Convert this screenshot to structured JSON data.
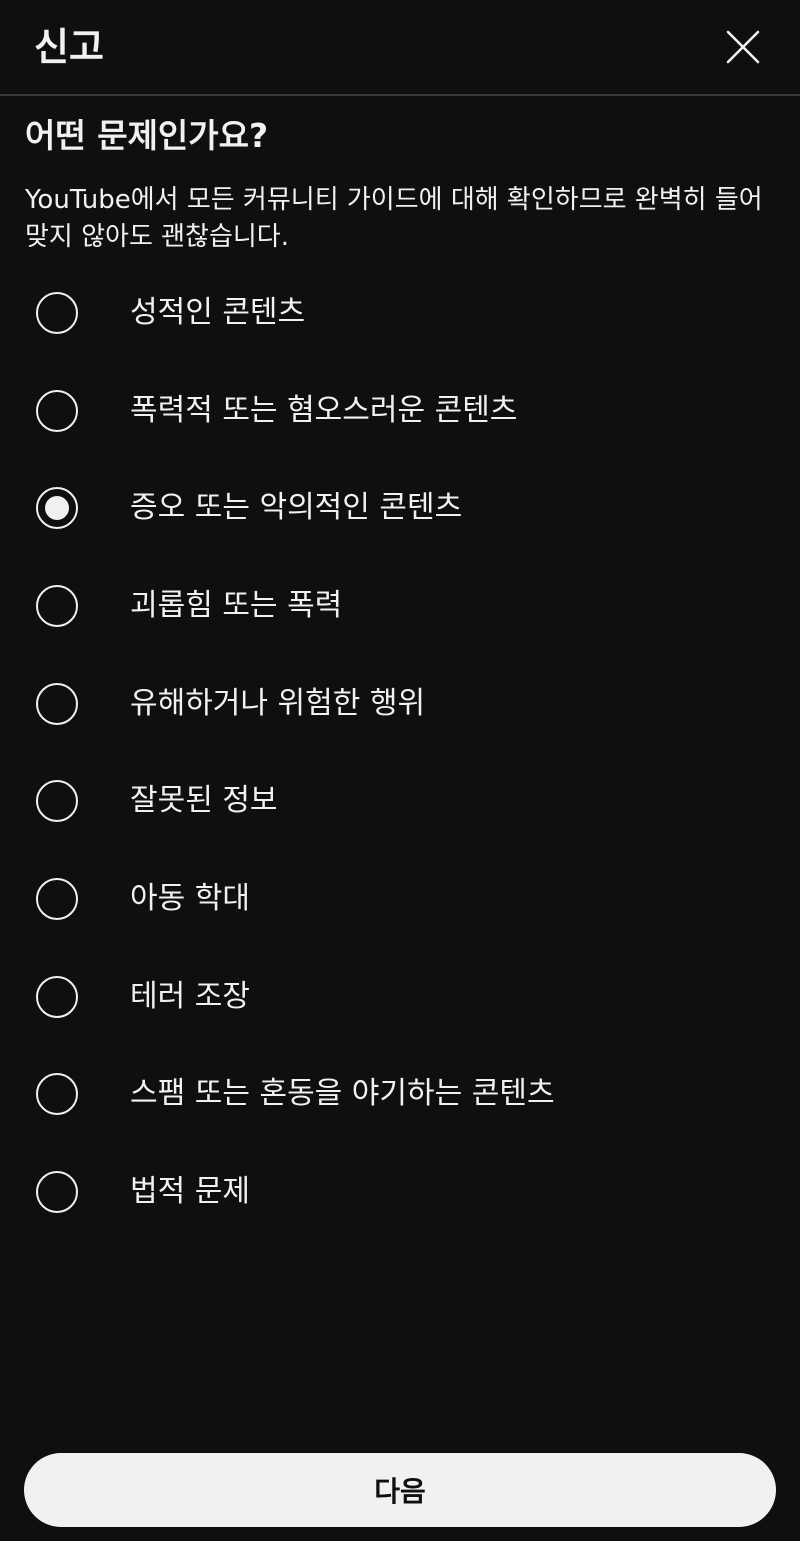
{
  "header": {
    "title": "신고",
    "close_icon": "close-icon"
  },
  "question": "어떤 문제인가요?",
  "description": "YouTube에서 모든 커뮤니티 가이드에 대해 확인하므로 완벽히 들어맞지 않아도 괜찮습니다.",
  "options": [
    {
      "label": "성적인 콘텐츠",
      "selected": false
    },
    {
      "label": "폭력적 또는 혐오스러운 콘텐츠",
      "selected": false
    },
    {
      "label": "증오 또는 악의적인 콘텐츠",
      "selected": true
    },
    {
      "label": "괴롭힘 또는 폭력",
      "selected": false
    },
    {
      "label": "유해하거나 위험한 행위",
      "selected": false
    },
    {
      "label": "잘못된 정보",
      "selected": false
    },
    {
      "label": "아동 학대",
      "selected": false
    },
    {
      "label": "테러 조장",
      "selected": false
    },
    {
      "label": "스팸 또는 혼동을 야기하는 콘텐츠",
      "selected": false
    },
    {
      "label": "법적 문제",
      "selected": false
    }
  ],
  "next_button": {
    "label": "다음"
  },
  "colors": {
    "background": "#0f0f0f",
    "text": "#f1f1f1",
    "button_bg": "#f1f1f1",
    "button_text": "#0f0f0f",
    "divider": "#3a3a3a"
  }
}
